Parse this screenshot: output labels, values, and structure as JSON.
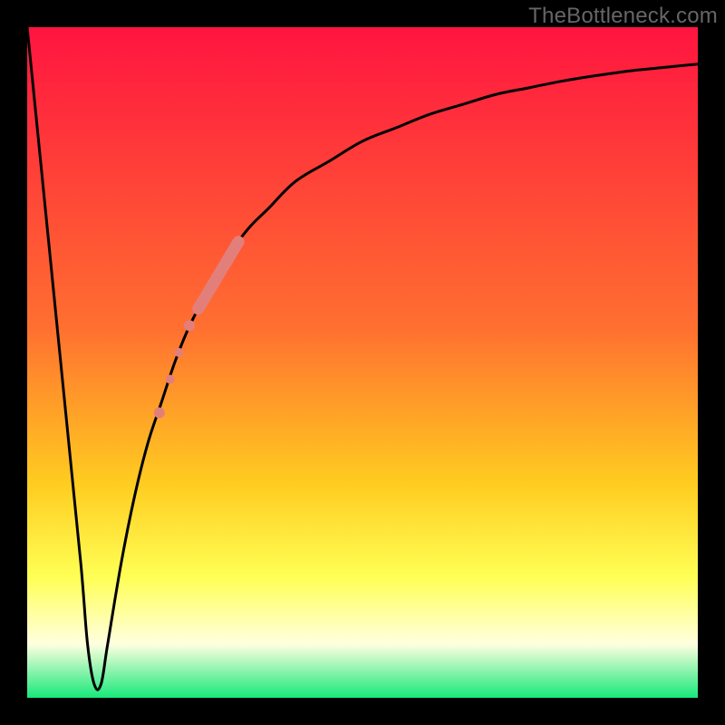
{
  "watermark": "TheBottleneck.com",
  "colors": {
    "gradient_top": "#ff1440",
    "gradient_mid1": "#ff7030",
    "gradient_mid2": "#ffcc20",
    "gradient_mid3": "#ffff55",
    "gradient_mid4": "#ffffe0",
    "gradient_bottom": "#17e87a",
    "curve_stroke": "#000000",
    "marker_fill": "#e37f7b",
    "frame": "#000000"
  },
  "chart_data": {
    "type": "line",
    "title": "",
    "xlabel": "",
    "ylabel": "",
    "xlim": [
      0,
      100
    ],
    "ylim": [
      0,
      100
    ],
    "series": [
      {
        "name": "bottleneck-curve",
        "x": [
          0,
          2,
          4,
          6,
          8,
          9,
          10,
          11,
          12,
          14,
          16,
          18,
          20,
          22,
          24,
          26,
          28,
          30,
          33,
          36,
          40,
          45,
          50,
          55,
          60,
          65,
          70,
          75,
          80,
          85,
          90,
          95,
          100
        ],
        "y": [
          100,
          80,
          60,
          40,
          20,
          8,
          2,
          2,
          8,
          20,
          30,
          38,
          44,
          50,
          55,
          59,
          63,
          66,
          70,
          73,
          77,
          80,
          83,
          85,
          87,
          88.5,
          90,
          91,
          92,
          92.8,
          93.5,
          94,
          94.5
        ]
      }
    ],
    "markers": [
      {
        "name": "thick-segment",
        "type": "segment",
        "x": [
          25.5,
          31.5
        ],
        "y": [
          58,
          68
        ],
        "width": 13
      },
      {
        "name": "dot-1",
        "type": "dot",
        "x": 24.2,
        "y": 55.5,
        "r": 6
      },
      {
        "name": "dot-2",
        "type": "dot",
        "x": 22.6,
        "y": 51.5,
        "r": 5
      },
      {
        "name": "dot-3",
        "type": "dot",
        "x": 21.3,
        "y": 47.5,
        "r": 5
      },
      {
        "name": "dot-4",
        "type": "dot",
        "x": 19.7,
        "y": 42.5,
        "r": 6
      }
    ],
    "gradient_bands": [
      {
        "stop": 0.0,
        "color_key": "gradient_top"
      },
      {
        "stop": 0.45,
        "color_key": "gradient_mid1"
      },
      {
        "stop": 0.68,
        "color_key": "gradient_mid2"
      },
      {
        "stop": 0.82,
        "color_key": "gradient_mid3"
      },
      {
        "stop": 0.92,
        "color_key": "gradient_mid4"
      },
      {
        "stop": 1.0,
        "color_key": "gradient_bottom"
      }
    ]
  }
}
